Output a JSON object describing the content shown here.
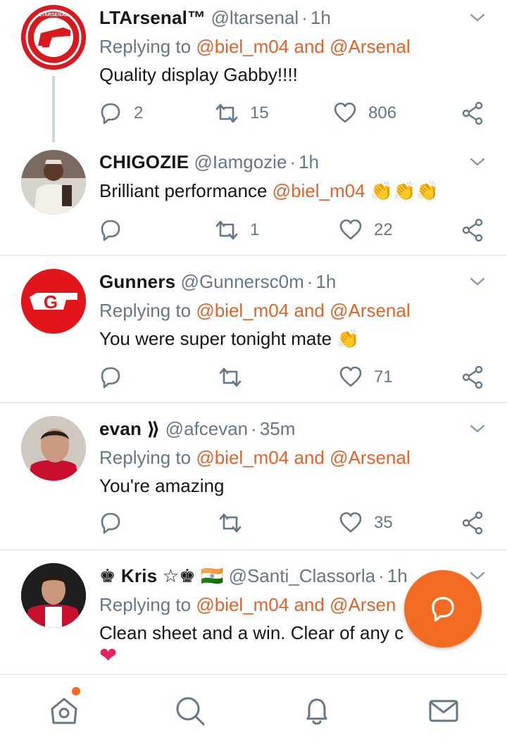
{
  "colors": {
    "accent": "#e0642c",
    "fab": "#f36a22",
    "secondary_text": "#657786",
    "divider": "#e6ecf0"
  },
  "tweets": [
    {
      "name": "LTArsenal™",
      "handle": "@ltarsenal",
      "sep": "·",
      "time": "1h",
      "replying_prefix": "Replying to",
      "mention1": "@biel_m04",
      "and": "and",
      "mention2": "@Arsenal",
      "text": "Quality display Gabby!!!!",
      "replies": "2",
      "retweets": "15",
      "likes": "806",
      "avatar_text": "LTARSENAL"
    },
    {
      "name": "CHIGOZIE",
      "handle": "@Iamgozie",
      "sep": "·",
      "time": "1h",
      "text": "Brilliant performance",
      "text_mention": "@biel_m04",
      "emoji": "👏👏👏",
      "replies": "",
      "retweets": "1",
      "likes": "22"
    },
    {
      "name": "Gunners",
      "handle": "@Gunnersc0m",
      "sep": "·",
      "time": "1h",
      "replying_prefix": "Replying to",
      "mention1": "@biel_m04",
      "and": "and",
      "mention2": "@Arsenal",
      "text": "You were super tonight mate",
      "emoji": "👏",
      "replies": "",
      "retweets": "",
      "likes": "71",
      "avatar_text": "G"
    },
    {
      "name": "evan ⟫",
      "handle": "@afcevan",
      "sep": "·",
      "time": "35m",
      "replying_prefix": "Replying to",
      "mention1": "@biel_m04",
      "and": "and",
      "mention2": "@Arsenal",
      "text": "You're amazing",
      "replies": "",
      "retweets": "",
      "likes": "35"
    },
    {
      "name": "♚ Kris ☆♚",
      "flag": "🇮🇳",
      "handle": "@Santi_Classorla",
      "sep": "·",
      "time": "1h",
      "replying_prefix": "Replying to",
      "mention1": "@biel_m04",
      "and": "and",
      "mention2": "@Arsen",
      "text": "Clean sheet and a win. Clear of any c",
      "heart": "❤"
    }
  ],
  "icons": {
    "reply": "reply-icon",
    "retweet": "retweet-icon",
    "like": "heart-icon",
    "share": "share-icon",
    "caret": "chevron-down-icon",
    "fab": "compose-reply-icon",
    "home": "home-icon",
    "search": "search-icon",
    "notifications": "bell-icon",
    "messages": "envelope-icon"
  }
}
